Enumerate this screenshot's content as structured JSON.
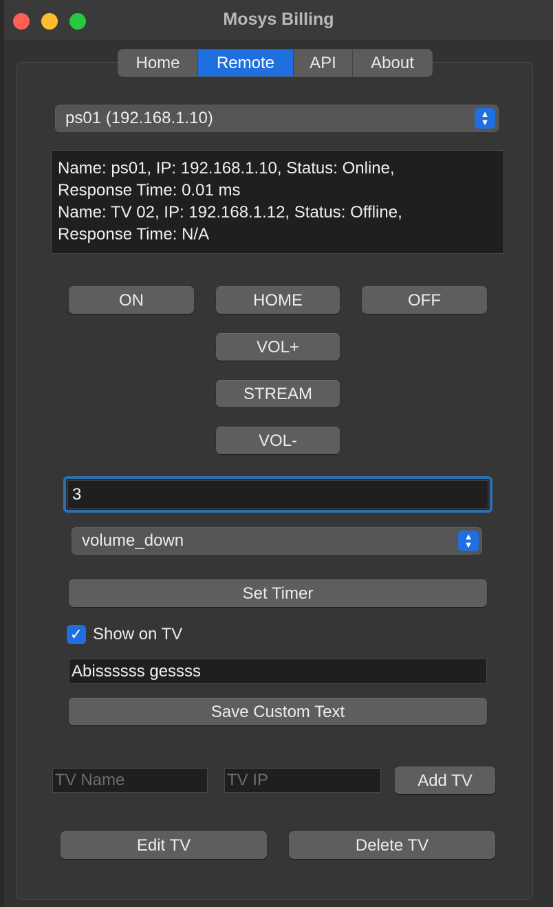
{
  "window": {
    "title": "Mosys Billing"
  },
  "tabs": [
    {
      "label": "Home",
      "active": false
    },
    {
      "label": "Remote",
      "active": true
    },
    {
      "label": "API",
      "active": false
    },
    {
      "label": "About",
      "active": false
    }
  ],
  "device_select": {
    "value": "ps01 (192.168.1.10)"
  },
  "status_box": {
    "lines": [
      "Name: ps01, IP: 192.168.1.10, Status: Online,",
      "Response Time: 0.01 ms",
      "Name: TV 02, IP: 192.168.1.12, Status: Offline,",
      "Response Time: N/A"
    ]
  },
  "remote": {
    "on": "ON",
    "home": "HOME",
    "off": "OFF",
    "vol_up": "VOL+",
    "stream": "STREAM",
    "vol_down": "VOL-"
  },
  "timer_input": {
    "value": "3"
  },
  "action_select": {
    "value": "volume_down"
  },
  "set_timer_label": "Set Timer",
  "show_on_tv": {
    "label": "Show on TV",
    "checked": true
  },
  "custom_text": {
    "value": "Abissssss gessss"
  },
  "save_custom_text_label": "Save Custom Text",
  "tv_name": {
    "placeholder": "TV Name"
  },
  "tv_ip": {
    "placeholder": "TV IP"
  },
  "add_tv_label": "Add TV",
  "edit_tv_label": "Edit TV",
  "delete_tv_label": "Delete TV",
  "colors": {
    "accent": "#1f6fe0",
    "focus_ring": "#2c6fb0",
    "window_bg": "#323232"
  }
}
